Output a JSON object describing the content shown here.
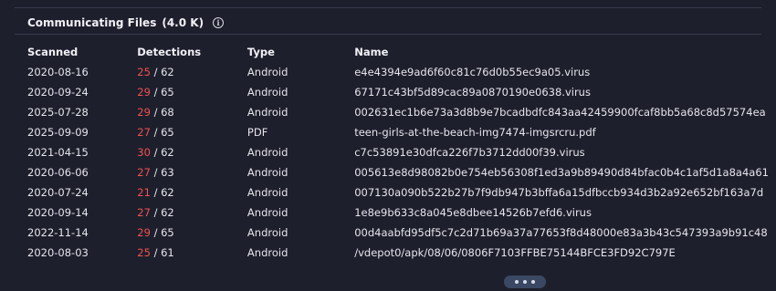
{
  "section": {
    "title": "Communicating Files",
    "count": "(4.0 K)",
    "info_icon": "info-circle-icon"
  },
  "table": {
    "headers": {
      "scanned": "Scanned",
      "detections": "Detections",
      "type": "Type",
      "name": "Name"
    },
    "rows": [
      {
        "scanned": "2020-08-16",
        "detections": "25",
        "total": "/ 62",
        "type": "Android",
        "name": "e4e4394e9ad6f60c81c76d0b55ec9a05.virus"
      },
      {
        "scanned": "2020-09-24",
        "detections": "29",
        "total": "/ 65",
        "type": "Android",
        "name": "67171c43bf5d89cac89a0870190e0638.virus"
      },
      {
        "scanned": "2025-07-28",
        "detections": "29",
        "total": "/ 68",
        "type": "Android",
        "name": "002631ec1b6e73a3d8b9e7bcadbdfc843aa42459900fcaf8bb5a68c8d57574ea"
      },
      {
        "scanned": "2025-09-09",
        "detections": "27",
        "total": "/ 65",
        "type": "PDF",
        "name": "teen-girls-at-the-beach-img7474-imgsrcru.pdf"
      },
      {
        "scanned": "2021-04-15",
        "detections": "30",
        "total": "/ 62",
        "type": "Android",
        "name": "c7c53891e30dfca226f7b3712dd00f39.virus"
      },
      {
        "scanned": "2020-06-06",
        "detections": "27",
        "total": "/ 63",
        "type": "Android",
        "name": "005613e8d98082b0e754eb56308f1ed3a9b89490d84bfac0b4c1af5d1a8a4a61"
      },
      {
        "scanned": "2020-07-24",
        "detections": "21",
        "total": "/ 62",
        "type": "Android",
        "name": "007130a090b522b27b7f9db947b3bffa6a15dfbccb934d3b2a92e652bf163a7d"
      },
      {
        "scanned": "2020-09-14",
        "detections": "27",
        "total": "/ 62",
        "type": "Android",
        "name": "1e8e9b633c8a045e8dbee14526b7efd6.virus"
      },
      {
        "scanned": "2022-11-14",
        "detections": "29",
        "total": "/ 65",
        "type": "Android",
        "name": "00d4aabfd95df5c7c2d71b69a37a77653f8d48000e83a3b43c547393a9b91c48"
      },
      {
        "scanned": "2020-08-03",
        "detections": "25",
        "total": "/ 61",
        "type": "Android",
        "name": "/vdepot0/apk/08/06/0806F7103FFBE75144BFCE3FD92C797E"
      }
    ]
  },
  "more_button": {
    "icon": "more-horizontal-icon"
  },
  "colors": {
    "background": "#1e1f2c",
    "detection_positive": "#f05252",
    "more_button": "#3b4863"
  }
}
